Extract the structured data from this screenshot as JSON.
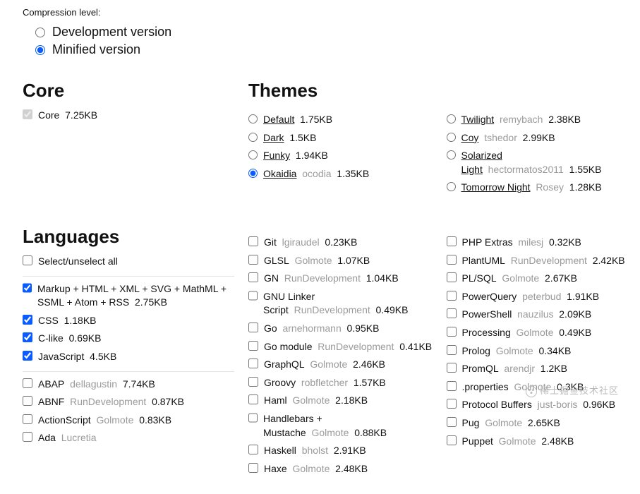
{
  "compression": {
    "label": "Compression level:",
    "options": [
      {
        "label": "Development version",
        "checked": false
      },
      {
        "label": "Minified version",
        "checked": true
      }
    ]
  },
  "core": {
    "heading": "Core",
    "items": [
      {
        "label": "Core",
        "size": "7.25KB",
        "checked": true,
        "disabled": true
      }
    ]
  },
  "themes": {
    "heading": "Themes",
    "col1": [
      {
        "label": "Default",
        "size": "1.75KB",
        "checked": false,
        "ul": true
      },
      {
        "label": "Dark",
        "size": "1.5KB",
        "checked": false,
        "ul": true
      },
      {
        "label": "Funky",
        "size": "1.94KB",
        "checked": false,
        "ul": true
      },
      {
        "label": "Okaidia",
        "author": "ocodia",
        "size": "1.35KB",
        "checked": true,
        "ul": true
      }
    ],
    "col2": [
      {
        "label": "Twilight",
        "author": "remybach",
        "size": "2.38KB",
        "checked": false,
        "ul": true
      },
      {
        "label": "Coy",
        "author": "tshedor",
        "size": "2.99KB",
        "checked": false,
        "ul": true
      },
      {
        "label": "Solarized Light",
        "author": "hectormatos2011",
        "size": "1.55KB",
        "checked": false,
        "ul": true
      },
      {
        "label": "Tomorrow Night",
        "author": "Rosey",
        "size": "1.28KB",
        "checked": false,
        "ul": true
      }
    ]
  },
  "languages": {
    "heading": "Languages",
    "selectall": "Select/unselect all",
    "defaults": [
      {
        "label": "Markup + HTML + XML + SVG + MathML + SSML + Atom + RSS",
        "size": "2.75KB",
        "checked": true
      },
      {
        "label": "CSS",
        "size": "1.18KB",
        "checked": true
      },
      {
        "label": "C-like",
        "size": "0.69KB",
        "checked": true
      },
      {
        "label": "JavaScript",
        "size": "4.5KB",
        "checked": true
      }
    ],
    "col1": [
      {
        "label": "ABAP",
        "author": "dellagustin",
        "size": "7.74KB"
      },
      {
        "label": "ABNF",
        "author": "RunDevelopment",
        "size": "0.87KB"
      },
      {
        "label": "ActionScript",
        "author": "Golmote",
        "size": "0.83KB"
      },
      {
        "label": "Ada",
        "author": "Lucretia"
      }
    ],
    "col2": [
      {
        "label": "Git",
        "author": "lgiraudel",
        "size": "0.23KB"
      },
      {
        "label": "GLSL",
        "author": "Golmote",
        "size": "1.07KB"
      },
      {
        "label": "GN",
        "author": "RunDevelopment",
        "size": "1.04KB"
      },
      {
        "label": "GNU Linker Script",
        "author": "RunDevelopment",
        "size": "0.49KB"
      },
      {
        "label": "Go",
        "author": "arnehormann",
        "size": "0.95KB"
      },
      {
        "label": "Go module",
        "author": "RunDevelopment",
        "size": "0.41KB"
      },
      {
        "label": "GraphQL",
        "author": "Golmote",
        "size": "2.46KB"
      },
      {
        "label": "Groovy",
        "author": "robfletcher",
        "size": "1.57KB"
      },
      {
        "label": "Haml",
        "author": "Golmote",
        "size": "2.18KB"
      },
      {
        "label": "Handlebars + Mustache",
        "author": "Golmote",
        "size": "0.88KB"
      },
      {
        "label": "Haskell",
        "author": "bholst",
        "size": "2.91KB"
      },
      {
        "label": "Haxe",
        "author": "Golmote",
        "size": "2.48KB"
      }
    ],
    "col3": [
      {
        "label": "PHP Extras",
        "author": "milesj",
        "size": "0.32KB"
      },
      {
        "label": "PlantUML",
        "author": "RunDevelopment",
        "size": "2.42KB"
      },
      {
        "label": "PL/SQL",
        "author": "Golmote",
        "size": "2.67KB"
      },
      {
        "label": "PowerQuery",
        "author": "peterbud",
        "size": "1.91KB"
      },
      {
        "label": "PowerShell",
        "author": "nauzilus",
        "size": "2.09KB"
      },
      {
        "label": "Processing",
        "author": "Golmote",
        "size": "0.49KB"
      },
      {
        "label": "Prolog",
        "author": "Golmote",
        "size": "0.34KB"
      },
      {
        "label": "PromQL",
        "author": "arendjr",
        "size": "1.2KB"
      },
      {
        "label": ".properties",
        "author": "Golmote",
        "size": "0.3KB"
      },
      {
        "label": "Protocol Buffers",
        "author": "just-boris",
        "size": "0.96KB"
      },
      {
        "label": "Pug",
        "author": "Golmote",
        "size": "2.65KB"
      },
      {
        "label": "Puppet",
        "author": "Golmote",
        "size": "2.48KB"
      }
    ]
  },
  "watermark": "稀土掘金技术社区"
}
